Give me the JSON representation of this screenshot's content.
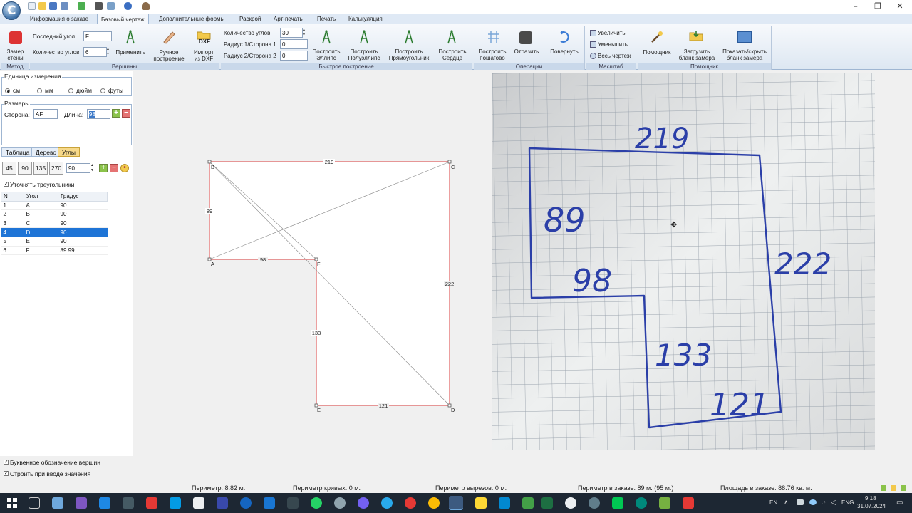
{
  "menu": {
    "tabs": [
      {
        "label": "Информация о заказе"
      },
      {
        "label": "Базовый чертеж"
      },
      {
        "label": "Дополнительные формы"
      },
      {
        "label": "Раскрой"
      },
      {
        "label": "Арт-печать"
      },
      {
        "label": "Печать"
      },
      {
        "label": "Калькуляция"
      }
    ]
  },
  "ribbon": {
    "metod": {
      "button_label_1": "Замер",
      "button_label_2": "стены",
      "group": "Метод"
    },
    "vertices": {
      "last_angle_label": "Последний угол",
      "last_angle_value": "F",
      "angle_count_label": "Количество углов",
      "angle_count_value": "6",
      "apply_label": "Применить",
      "manual_label_1": "Ручное",
      "manual_label_2": "построение",
      "import_label_1": "Импорт",
      "import_label_2": "из DXF",
      "dxf_text": "DXF",
      "group": "Вершины"
    },
    "quick": {
      "corners_label": "Количество углов",
      "corners_value": "30",
      "radius1_label": "Радиус 1/Сторона 1",
      "radius1_value": "0",
      "radius2_label": "Радиус 2/Сторона 2",
      "radius2_value": "0",
      "ellipse_1": "Построить",
      "ellipse_2": "Эллипс",
      "semi_1": "Построить",
      "semi_2": "Полуэллипс",
      "rect_1": "Построить",
      "rect_2": "Прямоугольник",
      "heart_1": "Построить",
      "heart_2": "Сердце",
      "group": "Быстрое построение"
    },
    "operations": {
      "step_1": "Построить",
      "step_2": "пошагово",
      "mirror": "Отразить",
      "rotate": "Повернуть",
      "group": "Операции"
    },
    "scale": {
      "zoom_in": "Увеличить",
      "zoom_out": "Уменьшить",
      "fit": "Весь чертеж",
      "group": "Масштаб"
    },
    "helper": {
      "helper": "Помощник",
      "load_1": "Загрузить",
      "load_2": "бланк замера",
      "toggle_1": "Показать/скрыть",
      "toggle_2": "бланк замера",
      "group": "Помощник"
    }
  },
  "left": {
    "units": {
      "legend": "Единица измерения",
      "options": [
        {
          "label": "см"
        },
        {
          "label": "мм"
        },
        {
          "label": "дюйм"
        },
        {
          "label": "футы"
        }
      ],
      "selected": "см"
    },
    "sizes": {
      "legend": "Размеры",
      "side_label": "Сторона:",
      "side_value": "AF",
      "length_label": "Длина:",
      "length_value": "98"
    },
    "tabs": [
      {
        "label": "Таблица"
      },
      {
        "label": "Дерево"
      },
      {
        "label": "Углы"
      }
    ],
    "angle_buttons": [
      {
        "label": "45"
      },
      {
        "label": "90"
      },
      {
        "label": "135"
      },
      {
        "label": "270"
      }
    ],
    "angle_input": "90",
    "refine_label": "Уточнять треугольники",
    "table": {
      "headers": {
        "n": "N",
        "angle": "Угол",
        "deg": "Градус"
      },
      "rows": [
        {
          "n": "1",
          "angle": "A",
          "deg": "90"
        },
        {
          "n": "2",
          "angle": "B",
          "deg": "90"
        },
        {
          "n": "3",
          "angle": "C",
          "deg": "90"
        },
        {
          "n": "4",
          "angle": "D",
          "deg": "90"
        },
        {
          "n": "5",
          "angle": "E",
          "deg": "90"
        },
        {
          "n": "6",
          "angle": "F",
          "deg": "89.99"
        }
      ],
      "selected_row": 3
    },
    "letter_vertices_label": "Буквенное обозначение вершин",
    "build_on_input_label": "Строить при вводе значения"
  },
  "drawing": {
    "vertices": {
      "A": "A",
      "B": "B",
      "C": "C",
      "D": "D",
      "E": "E",
      "F": "F"
    },
    "sides": {
      "BC": "219",
      "AB": "89",
      "AF": "98",
      "CD": "222",
      "FE": "133",
      "ED": "121"
    }
  },
  "photo": {
    "labels": {
      "top": "219",
      "left": "89",
      "middle": "98",
      "right": "222",
      "lower": "133",
      "bottom": "121"
    }
  },
  "status": {
    "perimeter": "Периметр: 8.82 м.",
    "curves": "Периметр кривых: 0 м.",
    "cutouts": "Периметр вырезов: 0 м.",
    "order_perimeter": "Периметр в заказе: 89 м. (95 м.)",
    "order_area": "Площадь в заказе: 88.76 кв. м."
  },
  "taskbar": {
    "lang": "EN",
    "kbd": "ENG",
    "time": "9:18",
    "date": "31.07.2024"
  },
  "colors": {
    "ribbon_bg": "#dde7f2",
    "outline": "#e06060",
    "selection": "#1e74d6",
    "taskbar": "#1d2733"
  }
}
